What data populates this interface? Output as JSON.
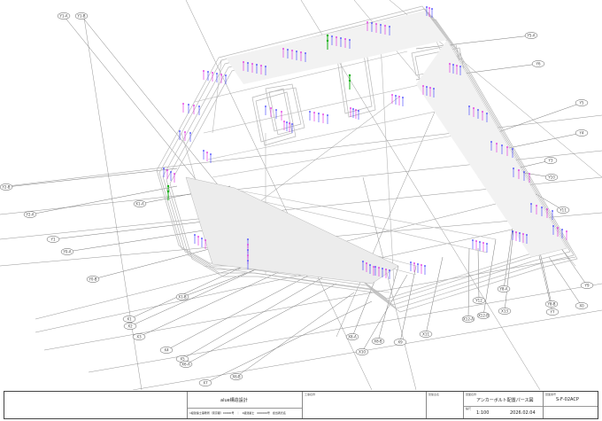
{
  "drawing": {
    "grid_labels": [
      {
        "text": "Y1-A"
      },
      {
        "text": "Y1-B"
      },
      {
        "text": "Y5-A"
      },
      {
        "text": "Y6"
      },
      {
        "text": "Y5"
      },
      {
        "text": "Y4"
      },
      {
        "text": "Y3"
      },
      {
        "text": "Y2-B"
      },
      {
        "text": "Y2-A"
      },
      {
        "text": "Y1"
      },
      {
        "text": "Y0-A"
      },
      {
        "text": "Y0-B"
      },
      {
        "text": "X1-A"
      },
      {
        "text": "X1-B"
      },
      {
        "text": "X1"
      },
      {
        "text": "X2"
      },
      {
        "text": "X3"
      },
      {
        "text": "X4"
      },
      {
        "text": "X5"
      },
      {
        "text": "X6-A"
      },
      {
        "text": "X6-B"
      },
      {
        "text": "X7"
      },
      {
        "text": "X8-A"
      },
      {
        "text": "X8-B"
      },
      {
        "text": "X9"
      },
      {
        "text": "X10"
      },
      {
        "text": "X11"
      },
      {
        "text": "X12-A"
      },
      {
        "text": "X12-B"
      },
      {
        "text": "X13"
      },
      {
        "text": "Y8-A"
      },
      {
        "text": "Y8-B"
      },
      {
        "text": "Y7"
      },
      {
        "text": "Y9"
      },
      {
        "text": "Y10"
      },
      {
        "text": "Y11"
      },
      {
        "text": "X0"
      },
      {
        "text": "Y12"
      }
    ]
  },
  "title_block": {
    "company": "alue構造設計",
    "company_detail": "1級建築士事務所（東京都）00000号　｜　1級建築士　000000号　担当者氏名",
    "project_label": "工事名称",
    "client_label": "建築主名",
    "drawing_label": "図面名称",
    "drawing_title": "アンカーボルト配置パース図",
    "scale_label": "縮尺",
    "scale": "1:100",
    "date": "2026.02.04",
    "number_label": "図面番号",
    "drawing_number": "S-F-02ACP"
  },
  "colors": {
    "structure": "#b8b8b8",
    "gridline": "#7a7a7a",
    "bolt_blue": "#3a3aff",
    "bolt_magenta": "#e020e0",
    "bolt_green": "#10b010"
  }
}
